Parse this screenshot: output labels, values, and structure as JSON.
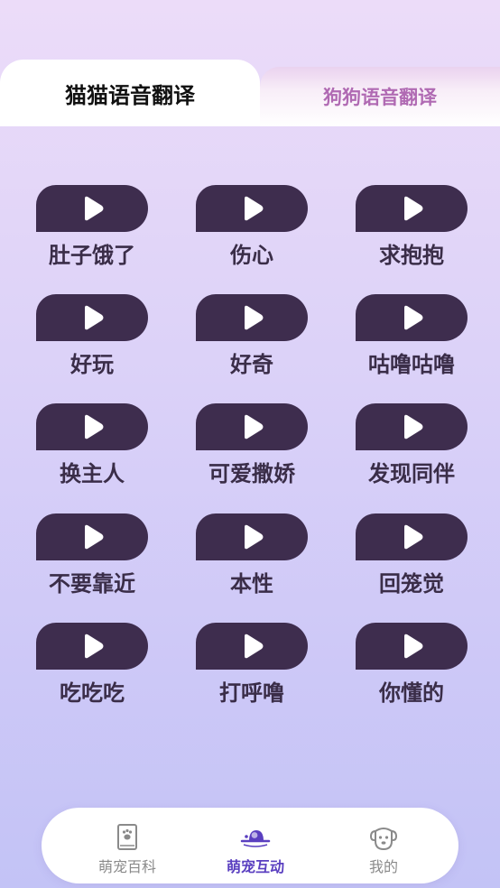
{
  "tabs": {
    "cat": "猫猫语音翻译",
    "dog": "狗狗语音翻译"
  },
  "sounds": [
    "肚子饿了",
    "伤心",
    "求抱抱",
    "好玩",
    "好奇",
    "咕噜咕噜",
    "换主人",
    "可爱撒娇",
    "发现同伴",
    "不要靠近",
    "本性",
    "回笼觉",
    "吃吃吃",
    "打呼噜",
    "你懂的"
  ],
  "nav": {
    "encyclopedia": "萌宠百科",
    "interaction": "萌宠互动",
    "mine": "我的"
  },
  "colors": {
    "pill": "#3e2d4e",
    "active_nav": "#5a3fc0",
    "dog_tab_text": "#b06ab3"
  }
}
